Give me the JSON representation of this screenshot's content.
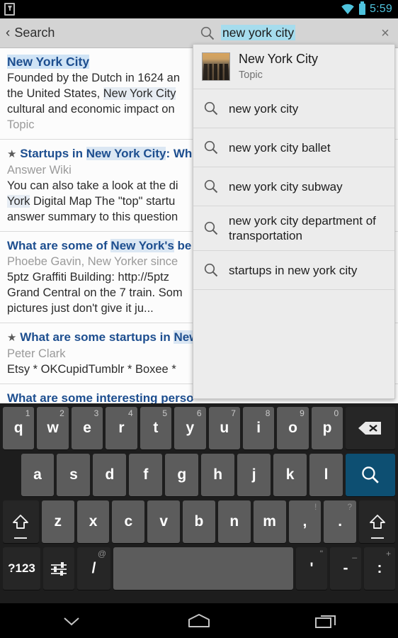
{
  "status_bar": {
    "download_icon": "download-indicator-icon",
    "wifi_icon": "wifi-icon",
    "battery_icon": "battery-icon",
    "time": "5:59",
    "accent_color": "#4fc3dd"
  },
  "action_bar": {
    "back_chevron": "‹",
    "back_label": "Search",
    "search_icon": "search-icon",
    "query_value": "new york city",
    "query_placeholder": "Search",
    "clear_icon": "×",
    "underline_color": "#2196c9",
    "selection_color": "#a5dced"
  },
  "results": [
    {
      "title_plain": "New York City",
      "title_highlight": true,
      "starred": false,
      "body": "Founded by the Dutch in 1624 an",
      "body2_pre": "the United States, ",
      "body2_hl": "New York City",
      "body3": "cultural and economic impact on",
      "subtitle": "Topic",
      "subtitle_position": "bottom"
    },
    {
      "starred": true,
      "title_pre": "Startups in ",
      "title_hl": "New York City",
      "title_post": ": Wh",
      "subtitle": "Answer Wiki",
      "body": "You can also take a look at the di",
      "body2_hl": "York",
      "body2_post": " Digital Map  The \"top\" startu",
      "body3": "answer summary to this question"
    },
    {
      "starred": false,
      "title_pre": "What are some of ",
      "title_hl": "New York's",
      "title_post": " be",
      "subtitle": "Phoebe Gavin, New Yorker since",
      "body": "5ptz Graffiti Building: http://5ptz",
      "body2": "Grand Central on the 7 train. Som",
      "body3": "pictures just don't give it ju..."
    },
    {
      "starred": true,
      "title_pre": "What are some startups in ",
      "title_hl": "New",
      "title_post": "",
      "subtitle": "Peter Clark",
      "body": "Etsy * OKCupidTumblr * Boxee * "
    },
    {
      "starred": false,
      "title_pre": "What are some interesting perso",
      "title_hl": "",
      "title_post": "",
      "subtitle": ""
    }
  ],
  "suggestions": [
    {
      "kind": "topic",
      "icon": "thumbnail-image",
      "label": "New York City",
      "type": "Topic"
    },
    {
      "kind": "query",
      "icon": "search-icon",
      "label": "new york city"
    },
    {
      "kind": "query",
      "icon": "search-icon",
      "label": "new york city ballet"
    },
    {
      "kind": "query",
      "icon": "search-icon",
      "label": "new york city subway"
    },
    {
      "kind": "query",
      "icon": "search-icon",
      "label": "new york city department of transportation"
    },
    {
      "kind": "query",
      "icon": "search-icon",
      "label": "startups in new york city"
    }
  ],
  "keyboard": {
    "row1": [
      {
        "label": "q",
        "alt": "1"
      },
      {
        "label": "w",
        "alt": "2"
      },
      {
        "label": "e",
        "alt": "3"
      },
      {
        "label": "r",
        "alt": "4"
      },
      {
        "label": "t",
        "alt": "5"
      },
      {
        "label": "y",
        "alt": "6"
      },
      {
        "label": "u",
        "alt": "7"
      },
      {
        "label": "i",
        "alt": "8"
      },
      {
        "label": "o",
        "alt": "9"
      },
      {
        "label": "p",
        "alt": "0"
      }
    ],
    "backspace_icon": "backspace-icon",
    "row2": [
      {
        "label": "a"
      },
      {
        "label": "s"
      },
      {
        "label": "d"
      },
      {
        "label": "f"
      },
      {
        "label": "g"
      },
      {
        "label": "h"
      },
      {
        "label": "j"
      },
      {
        "label": "k"
      },
      {
        "label": "l"
      }
    ],
    "enter_icon": "search-enter-icon",
    "enter_color": "#0d4f72",
    "shift_icon": "shift-icon",
    "row3": [
      {
        "label": "z"
      },
      {
        "label": "x"
      },
      {
        "label": "c"
      },
      {
        "label": "v"
      },
      {
        "label": "b"
      },
      {
        "label": "n"
      },
      {
        "label": "m"
      },
      {
        "label": ",",
        "alt": "!"
      },
      {
        "label": ".",
        "alt": "?"
      }
    ],
    "row4": {
      "symbols_label": "?123",
      "settings_icon": "keyboard-settings-icon",
      "slash_label": "/",
      "slash_alt": "@",
      "space_label": "",
      "apostrophe_label": "'",
      "apostrophe_alt": "\"",
      "dash_label": "-",
      "dash_alt": "_",
      "colon_label": ":",
      "colon_alt": "+"
    }
  },
  "nav_bar": {
    "back_icon": "hide-keyboard-chevron-icon",
    "home_icon": "home-icon",
    "recents_icon": "recent-apps-icon"
  }
}
